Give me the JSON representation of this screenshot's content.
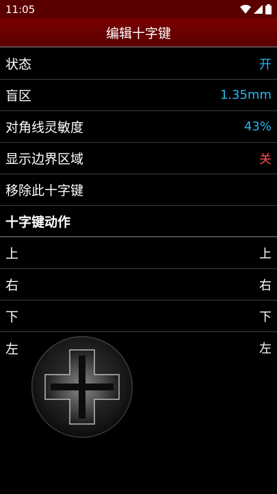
{
  "status_bar": {
    "time": "11:05"
  },
  "app_bar": {
    "title": "编辑十字键"
  },
  "settings": [
    {
      "label": "状态",
      "value": "开",
      "value_color": "#29b6f6"
    },
    {
      "label": "盲区",
      "value": "1.35mm",
      "value_color": "#29b6f6"
    },
    {
      "label": "对角线灵敏度",
      "value": "43%",
      "value_color": "#29b6f6"
    },
    {
      "label": "显示边界区域",
      "value": "关",
      "value_color": "#ff4d4d"
    },
    {
      "label": "移除此十字键",
      "value": ""
    }
  ],
  "actions_header": "十字键动作",
  "actions": [
    {
      "label": "上",
      "value": "上"
    },
    {
      "label": "右",
      "value": "右"
    },
    {
      "label": "下",
      "value": "下"
    },
    {
      "label": "左",
      "value": "左"
    }
  ],
  "icons": {
    "wifi": "wifi-icon",
    "signal": "signal-icon",
    "battery": "battery-icon",
    "dpad": "dpad-icon"
  }
}
